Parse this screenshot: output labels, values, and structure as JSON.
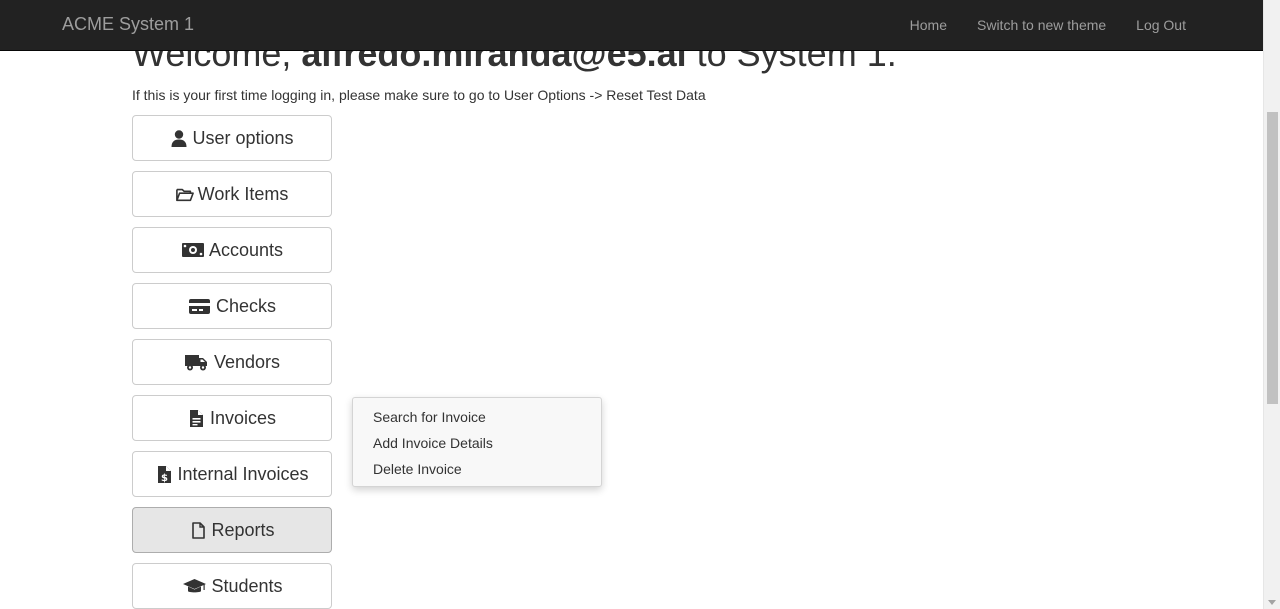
{
  "navbar": {
    "brand": "ACME System 1",
    "links": [
      {
        "label": "Home"
      },
      {
        "label": "Switch to new theme"
      },
      {
        "label": "Log Out"
      }
    ]
  },
  "welcome": {
    "prefix": "Welcome, ",
    "user": "alfredo.miranda@e5.ai",
    "suffix": " to System 1."
  },
  "first_time_message": "If this is your first time logging in, please make sure to go to User Options -> Reset Test Data",
  "menu": [
    {
      "label": "User options",
      "icon": "user-icon"
    },
    {
      "label": "Work Items",
      "icon": "folder-open-icon"
    },
    {
      "label": "Accounts",
      "icon": "money-bill-icon"
    },
    {
      "label": "Checks",
      "icon": "credit-card-icon"
    },
    {
      "label": "Vendors",
      "icon": "truck-icon"
    },
    {
      "label": "Invoices",
      "icon": "file-invoice-icon"
    },
    {
      "label": "Internal Invoices",
      "icon": "file-invoice-dollar-icon"
    },
    {
      "label": "Reports",
      "icon": "file-icon",
      "active": true
    },
    {
      "label": "Students",
      "icon": "graduation-cap-icon"
    }
  ],
  "invoice_popup": {
    "items": [
      {
        "label": "Search for Invoice"
      },
      {
        "label": "Add Invoice Details"
      },
      {
        "label": "Delete Invoice"
      }
    ]
  }
}
